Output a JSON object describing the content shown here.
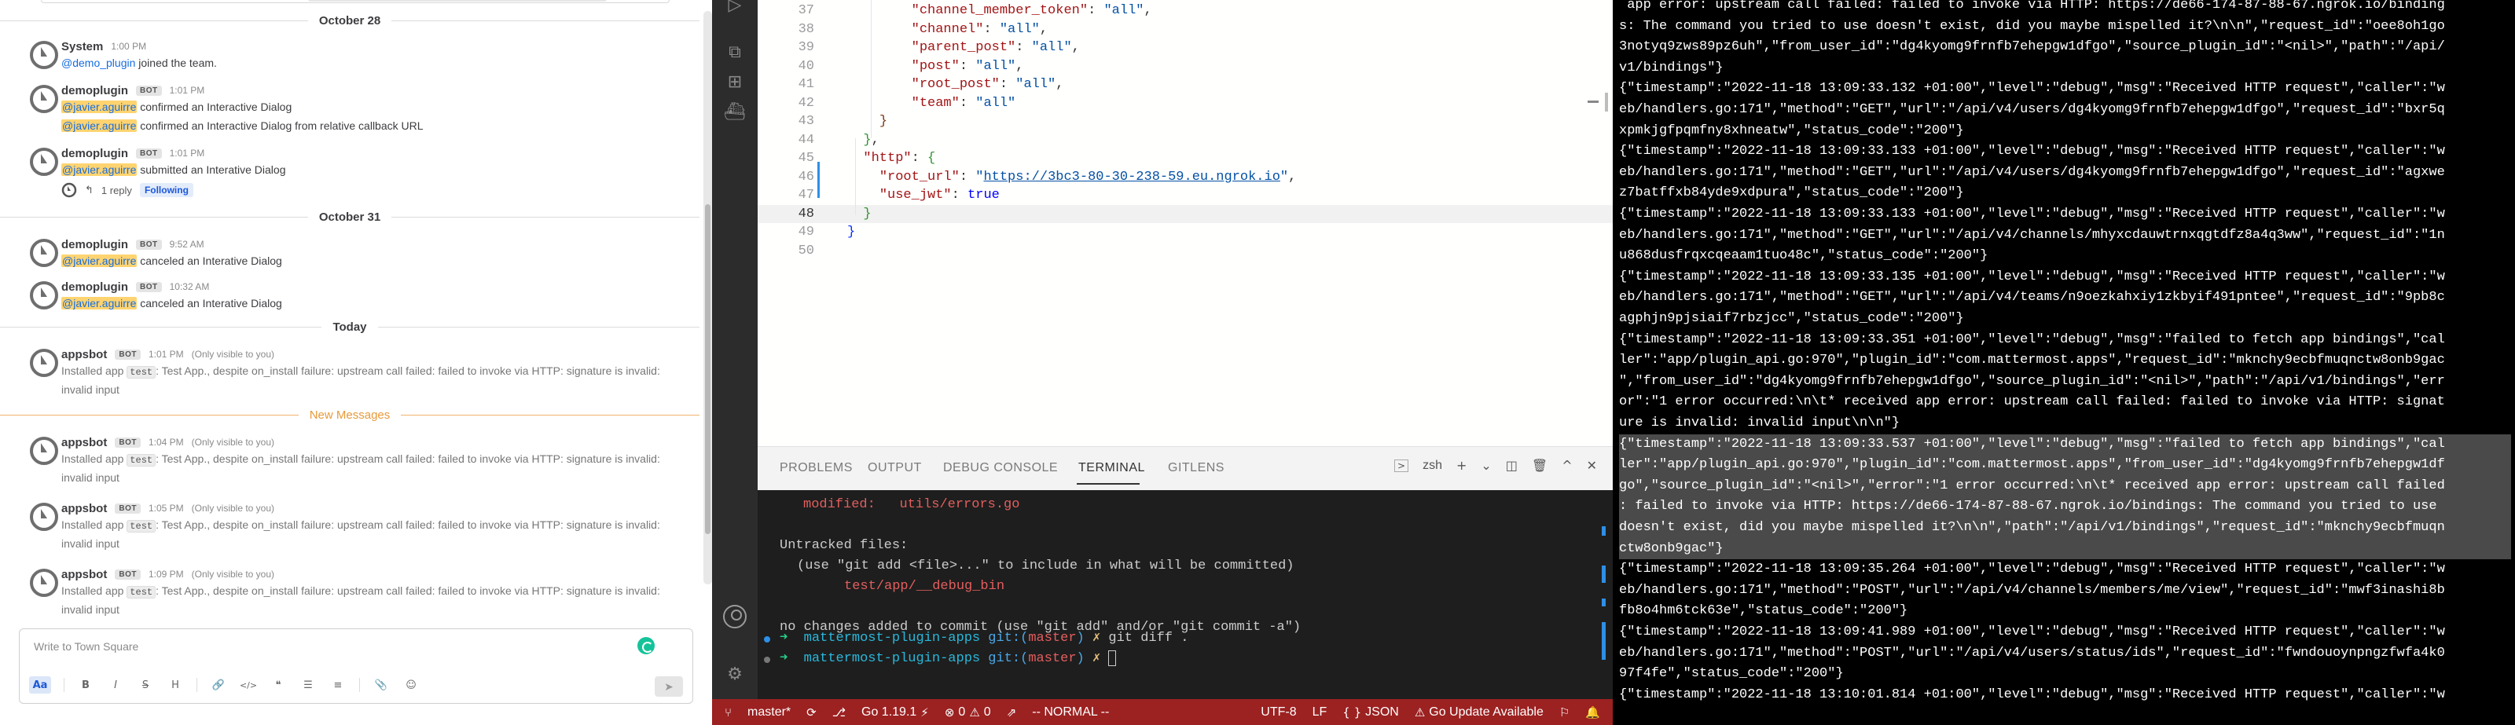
{
  "chat": {
    "dates": {
      "oct28": "October 28",
      "oct31": "October 31",
      "today": "Today",
      "new_messages": "New Messages"
    },
    "posts": {
      "p1": {
        "user": "System",
        "time": "1:00 PM",
        "mention": "@demo_plugin",
        "text": " joined the team."
      },
      "p2": {
        "user": "demoplugin",
        "bot": "BOT",
        "time": "1:01 PM",
        "m1": "@javier.aguirre",
        "t1": " confirmed an Interactive Dialog",
        "m2": "@javier.aguirre",
        "t2": " confirmed an Interactive Dialog from relative callback URL"
      },
      "p3": {
        "user": "demoplugin",
        "bot": "BOT",
        "time": "1:01 PM",
        "mention": "@javier.aguirre",
        "text": " submitted an Interative Dialog",
        "reply": "1 reply",
        "following": "Following"
      },
      "p4": {
        "user": "demoplugin",
        "bot": "BOT",
        "time": "9:52 AM",
        "mention": "@javier.aguirre",
        "text": " canceled an Interative Dialog"
      },
      "p5": {
        "user": "demoplugin",
        "bot": "BOT",
        "time": "10:32 AM",
        "mention": "@javier.aguirre",
        "text": " canceled an Interative Dialog"
      },
      "p6": {
        "user": "appsbot",
        "bot": "BOT",
        "time": "1:01 PM",
        "only": "(Only visible to you)",
        "pre": "Installed app ",
        "code": "test",
        "post": ": Test App., despite on_install failure: upstream call failed: failed to invoke via HTTP: signature is invalid:",
        "cont": "invalid input"
      },
      "p7": {
        "user": "appsbot",
        "bot": "BOT",
        "time": "1:04 PM",
        "only": "(Only visible to you)",
        "pre": "Installed app ",
        "code": "test",
        "post": ": Test App., despite on_install failure: upstream call failed: failed to invoke via HTTP: signature is invalid:",
        "cont": "invalid input"
      },
      "p8": {
        "user": "appsbot",
        "bot": "BOT",
        "time": "1:05 PM",
        "only": "(Only visible to you)",
        "pre": "Installed app ",
        "code": "test",
        "post": ": Test App., despite on_install failure: upstream call failed: failed to invoke via HTTP: signature is invalid:",
        "cont": "invalid input"
      },
      "p9": {
        "user": "appsbot",
        "bot": "BOT",
        "time": "1:09 PM",
        "only": "(Only visible to you)",
        "pre": "Installed app ",
        "code": "test",
        "post": ": Test App., despite on_install failure: upstream call failed: failed to invoke via HTTP: signature is invalid:",
        "cont": "invalid input"
      }
    },
    "composer": {
      "placeholder": "Write to Town Square",
      "tools": {
        "format": "Aa",
        "bold": "B",
        "italic": "I",
        "strike": "S",
        "heading": "H",
        "link": "🔗",
        "code": "</>",
        "quote": "❝",
        "ul": "☰",
        "ol": "≡",
        "attach": "📎",
        "emoji": "☺"
      },
      "send": "➤"
    }
  },
  "editor": {
    "lines": [
      {
        "n": "37",
        "parts": [
          [
            "",
            "        "
          ],
          [
            "k",
            "\"channel_member_token\""
          ],
          [
            "",
            ": "
          ],
          [
            "s",
            "\"all\""
          ],
          [
            "",
            ","
          ]
        ]
      },
      {
        "n": "38",
        "parts": [
          [
            "",
            "        "
          ],
          [
            "k",
            "\"channel\""
          ],
          [
            "",
            ": "
          ],
          [
            "s",
            "\"all\""
          ],
          [
            "",
            ","
          ]
        ]
      },
      {
        "n": "39",
        "parts": [
          [
            "",
            "        "
          ],
          [
            "k",
            "\"parent_post\""
          ],
          [
            "",
            ": "
          ],
          [
            "s",
            "\"all\""
          ],
          [
            "",
            ","
          ]
        ]
      },
      {
        "n": "40",
        "parts": [
          [
            "",
            "        "
          ],
          [
            "k",
            "\"post\""
          ],
          [
            "",
            ": "
          ],
          [
            "s",
            "\"all\""
          ],
          [
            "",
            ","
          ]
        ]
      },
      {
        "n": "41",
        "parts": [
          [
            "",
            "        "
          ],
          [
            "k",
            "\"root_post\""
          ],
          [
            "",
            ": "
          ],
          [
            "s",
            "\"all\""
          ],
          [
            "",
            ","
          ]
        ]
      },
      {
        "n": "42",
        "parts": [
          [
            "",
            "        "
          ],
          [
            "k",
            "\"team\""
          ],
          [
            "",
            ": "
          ],
          [
            "s",
            "\"all\""
          ]
        ]
      },
      {
        "n": "43",
        "parts": [
          [
            "",
            "    "
          ],
          [
            "p3",
            "}"
          ]
        ]
      },
      {
        "n": "44",
        "parts": [
          [
            "",
            "  "
          ],
          [
            "p2",
            "}"
          ],
          [
            "",
            ","
          ]
        ]
      },
      {
        "n": "45",
        "parts": [
          [
            "",
            "  "
          ],
          [
            "k",
            "\"http\""
          ],
          [
            "",
            ": "
          ],
          [
            "p2",
            "{"
          ]
        ]
      },
      {
        "n": "46",
        "parts": [
          [
            "",
            "    "
          ],
          [
            "k",
            "\"root_url\""
          ],
          [
            "",
            ": "
          ],
          [
            "s",
            "\""
          ],
          [
            "url",
            "https://3bc3-80-30-238-59.eu.ngrok.io"
          ],
          [
            "s",
            "\""
          ],
          [
            "",
            ","
          ]
        ]
      },
      {
        "n": "47",
        "parts": [
          [
            "",
            "    "
          ],
          [
            "k",
            "\"use_jwt\""
          ],
          [
            "",
            ": "
          ],
          [
            "b",
            "true"
          ]
        ]
      },
      {
        "n": "48",
        "parts": [
          [
            "",
            "  "
          ],
          [
            "p2",
            "}"
          ]
        ]
      },
      {
        "n": "49",
        "parts": [
          [
            "p1",
            "}"
          ]
        ]
      },
      {
        "n": "50",
        "parts": []
      }
    ],
    "panel_tabs": {
      "problems": "PROBLEMS",
      "output": "OUTPUT",
      "debug": "DEBUG CONSOLE",
      "terminal": "TERMINAL",
      "gitlens": "GITLENS"
    },
    "panel_controls": {
      "shell": "zsh",
      "add": "+",
      "dropdown": "⌄",
      "split": "◫",
      "trash": "🗑",
      "maximize": "^",
      "close": "✕"
    }
  },
  "terminal": {
    "modified_label": "modified:",
    "modified_file": "utils/errors.go",
    "untracked": "Untracked files:",
    "hint": "(use \"git add <file>...\" to include in what will be committed)",
    "untracked_file": "test/app/__debug_bin",
    "no_changes": "no changes added to commit (use \"git add\" and/or \"git commit -a\")",
    "prompt_dir": "mattermost-plugin-apps",
    "prompt_git": "git:(",
    "prompt_branch": "master",
    "prompt_close": ")",
    "prompt_mark": "✗",
    "cmd": "git diff .",
    "arrow": "➜"
  },
  "statusbar": {
    "branch": "master*",
    "sync": "⟳",
    "go_version": "Go 1.19.1",
    "errors": "0",
    "warnings": "0",
    "mode": "-- NORMAL --",
    "encoding": "UTF-8",
    "eol": "LF",
    "lang": "JSON",
    "update": "Go Update Available",
    "colors": {
      "background": "#9c2121"
    }
  },
  "logs": [
    " app error: upstream call failed: failed to invoke via HTTP: https://de66-174-87-88-67.ngrok.io/binding",
    "s: The command you tried to use doesn't exist, did you maybe mispelled it?\\n\\n\",\"request_id\":\"oee8oh1go",
    "3notyq9zws89pz6uh\",\"from_user_id\":\"dg4kyomg9frnfb7ehepgw1dfgo\",\"source_plugin_id\":\"<nil>\",\"path\":\"/api/",
    "v1/bindings\"}",
    "{\"timestamp\":\"2022-11-18 13:09:33.132 +01:00\",\"level\":\"debug\",\"msg\":\"Received HTTP request\",\"caller\":\"w",
    "eb/handlers.go:171\",\"method\":\"GET\",\"url\":\"/api/v4/users/dg4kyomg9frnfb7ehepgw1dfgo\",\"request_id\":\"bxr5q",
    "xpmkjgfpqmfny8xhneatw\",\"status_code\":\"200\"}",
    "{\"timestamp\":\"2022-11-18 13:09:33.133 +01:00\",\"level\":\"debug\",\"msg\":\"Received HTTP request\",\"caller\":\"w",
    "eb/handlers.go:171\",\"method\":\"GET\",\"url\":\"/api/v4/users/dg4kyomg9frnfb7ehepgw1dfgo\",\"request_id\":\"agxwe",
    "z7batffxb84yde9xdpura\",\"status_code\":\"200\"}",
    "{\"timestamp\":\"2022-11-18 13:09:33.133 +01:00\",\"level\":\"debug\",\"msg\":\"Received HTTP request\",\"caller\":\"w",
    "eb/handlers.go:171\",\"method\":\"GET\",\"url\":\"/api/v4/channels/mhyxcdauwtrnxqgtdfz8a4q3ww\",\"request_id\":\"1n",
    "u868dusfrqxcqeaam1tuo48c\",\"status_code\":\"200\"}",
    "{\"timestamp\":\"2022-11-18 13:09:33.135 +01:00\",\"level\":\"debug\",\"msg\":\"Received HTTP request\",\"caller\":\"w",
    "eb/handlers.go:171\",\"method\":\"GET\",\"url\":\"/api/v4/teams/n9oezkahxiy1zkbyif491pntee\",\"request_id\":\"9pb8c",
    "agphjn9pjsiaif7rbzjcc\",\"status_code\":\"200\"}",
    "{\"timestamp\":\"2022-11-18 13:09:33.351 +01:00\",\"level\":\"debug\",\"msg\":\"failed to fetch app bindings\",\"cal",
    "ler\":\"app/plugin_api.go:970\",\"plugin_id\":\"com.mattermost.apps\",\"request_id\":\"mknchy9ecbfmuqnctw8onb9gac",
    "\",\"from_user_id\":\"dg4kyomg9frnfb7ehepgw1dfgo\",\"source_plugin_id\":\"<nil>\",\"path\":\"/api/v1/bindings\",\"err",
    "or\":\"1 error occurred:\\n\\t* received app error: upstream call failed: failed to invoke via HTTP: signat",
    "ure is invalid: invalid input\\n\\n\"}",
    "{\"timestamp\":\"2022-11-18 13:09:33.537 +01:00\",\"level\":\"debug\",\"msg\":\"failed to fetch app bindings\",\"cal",
    "ler\":\"app/plugin_api.go:970\",\"plugin_id\":\"com.mattermost.apps\",\"from_user_id\":\"dg4kyomg9frnfb7ehepgw1df",
    "go\",\"source_plugin_id\":\"<nil>\",\"error\":\"1 error occurred:\\n\\t* received app error: upstream call failed",
    ": failed to invoke via HTTP: https://de66-174-87-88-67.ngrok.io/bindings: The command you tried to use ",
    "doesn't exist, did you maybe mispelled it?\\n\\n\",\"path\":\"/api/v1/bindings\",\"request_id\":\"mknchy9ecbfmuqn",
    "ctw8onb9gac\"}",
    "{\"timestamp\":\"2022-11-18 13:09:35.264 +01:00\",\"level\":\"debug\",\"msg\":\"Received HTTP request\",\"caller\":\"w",
    "eb/handlers.go:171\",\"method\":\"POST\",\"url\":\"/api/v4/channels/members/me/view\",\"request_id\":\"mwf3inashi8b",
    "fb8o4hm6tck63e\",\"status_code\":\"200\"}",
    "{\"timestamp\":\"2022-11-18 13:09:41.989 +01:00\",\"level\":\"debug\",\"msg\":\"Received HTTP request\",\"caller\":\"w",
    "eb/handlers.go:171\",\"method\":\"POST\",\"url\":\"/api/v4/users/status/ids\",\"request_id\":\"fwndouoynpngzfwfa4k0",
    "97f4fe\",\"status_code\":\"200\"}",
    "{\"timestamp\":\"2022-11-18 13:10:01.814 +01:00\",\"level\":\"debug\",\"msg\":\"Received HTTP request\",\"caller\":\"w"
  ],
  "highlighted_log_rows": [
    21,
    22,
    23,
    24,
    25,
    26
  ]
}
